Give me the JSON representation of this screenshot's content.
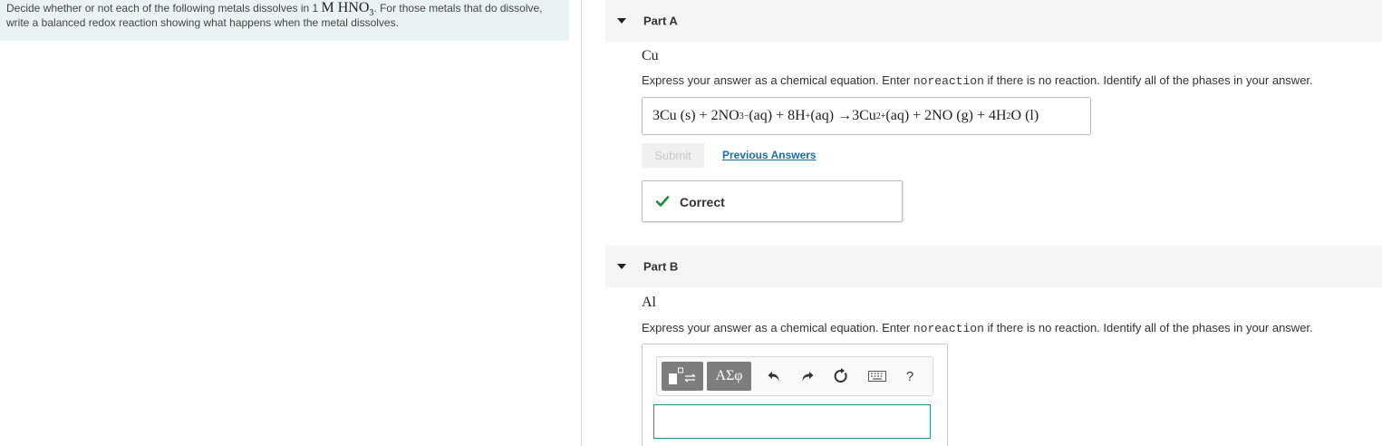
{
  "intro": {
    "text_before": "Decide whether or not each of the following metals dissolves in 1",
    "formula_main": "M HNO",
    "formula_sub": "3",
    "text_after": ". For those metals that do dissolve, write a balanced redox reaction showing what happens when the metal dissolves."
  },
  "parts": [
    {
      "title": "Part A",
      "metal": "Cu",
      "instruction_before": "Express your answer as a chemical equation. Enter ",
      "instruction_code": "noreaction",
      "instruction_after": " if there is no reaction. Identify all of the phases in your answer.",
      "answer": {
        "t1": "3Cu (s) + 2NO",
        "sub1": "3",
        "sup1": "−",
        "t2": " (aq) + 8H",
        "sup2": "+",
        "t3": " (aq) →3Cu",
        "sup3": "2+",
        "t4": " (aq) + 2NO (g) + 4H",
        "sub4": "2",
        "t5": "O (l)"
      },
      "submit_label": "Submit",
      "previous_answers_label": "Previous Answers",
      "feedback_label": "Correct",
      "feedback_color": "#1e8a3c"
    },
    {
      "title": "Part B",
      "metal": "Al",
      "instruction_before": "Express your answer as a chemical equation. Enter ",
      "instruction_code": "noreaction",
      "instruction_after": " if there is no reaction. Identify all of the phases in your answer.",
      "toolbar": {
        "greek_label": "ΑΣφ",
        "help_label": "?"
      },
      "input_value": ""
    }
  ],
  "icons": [
    "caret-down-icon",
    "check-icon",
    "template-icon",
    "undo-icon",
    "redo-icon",
    "reset-icon",
    "keyboard-icon",
    "help-icon"
  ]
}
